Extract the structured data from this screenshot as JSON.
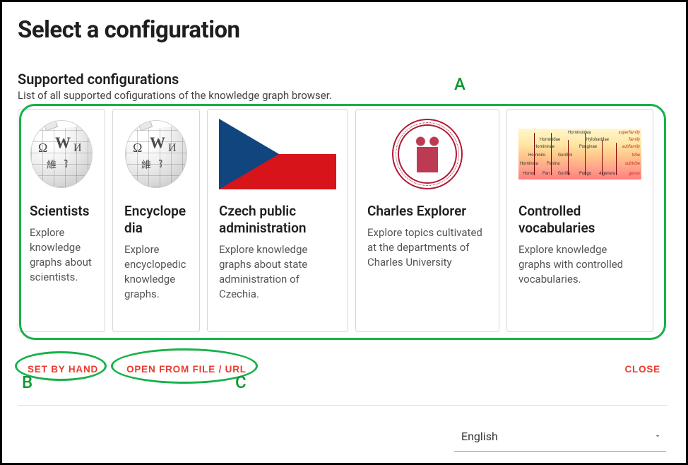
{
  "header": {
    "title": "Select a configuration"
  },
  "section": {
    "subtitle": "Supported configurations",
    "description": "List of all supported cofigurations of the knowledge graph browser."
  },
  "cards": [
    {
      "title": "Scientists",
      "description": "Explore knowledge graphs about scientists.",
      "icon": "wikipedia-globe"
    },
    {
      "title": "Encyclopedia",
      "description": "Explore encyclopedic knowledge graphs.",
      "icon": "wikipedia-globe"
    },
    {
      "title": "Czech public administration",
      "description": "Explore knowledge graphs about state administration of Czechia.",
      "icon": "czech-flag"
    },
    {
      "title": "Charles Explorer",
      "description": "Explore topics cultivated at the departments of Charles University",
      "icon": "charles-university-seal"
    },
    {
      "title": "Controlled vocabularies",
      "description": "Explore knowledge graphs with controlled vocabularies.",
      "icon": "taxonomy-table"
    }
  ],
  "actions": {
    "set_by_hand": "SET BY HAND",
    "open_from_file": "OPEN FROM FILE / URL",
    "close": "CLOSE"
  },
  "language": {
    "selected": "English"
  },
  "annotations": {
    "A": "A",
    "B": "B",
    "C": "C"
  }
}
